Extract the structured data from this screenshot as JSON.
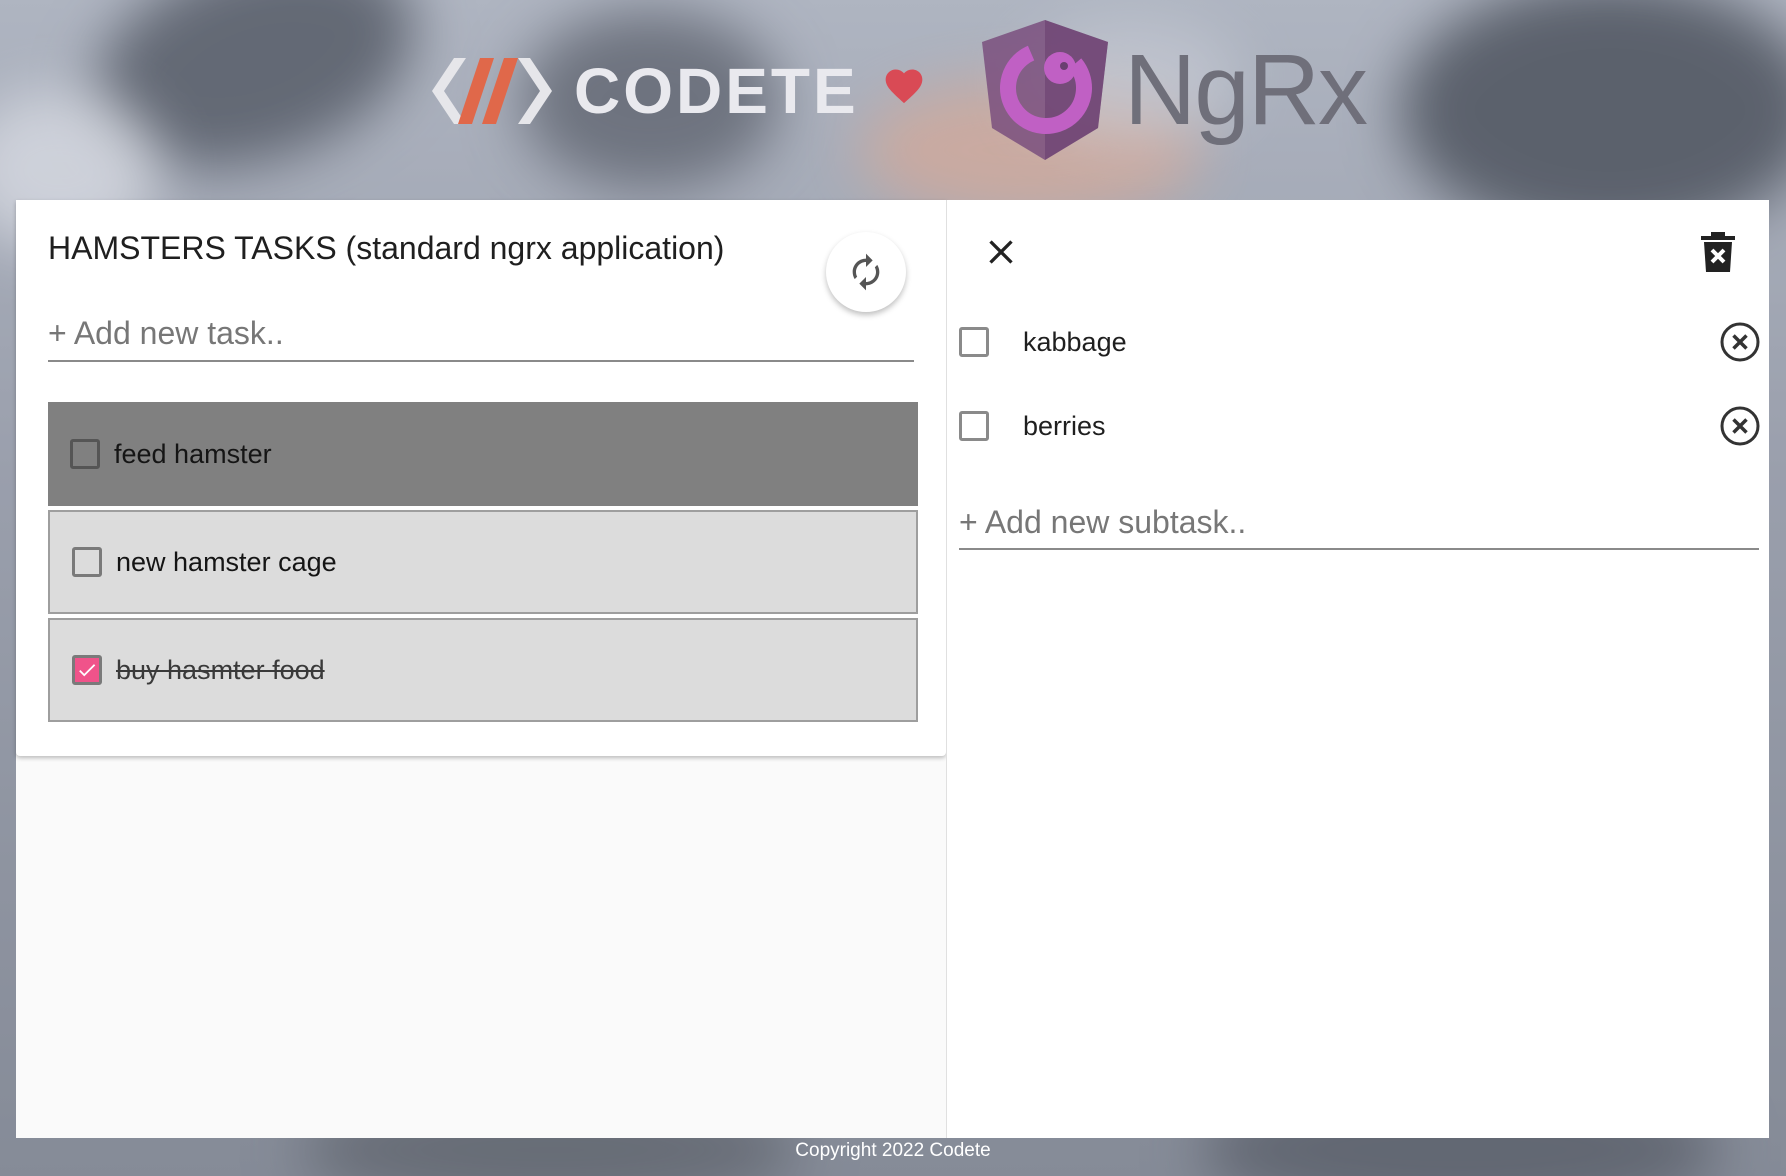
{
  "header": {
    "codete_logo_text": "CODETE",
    "ngrx_logo_text": "NgRx"
  },
  "tasks_panel": {
    "title": "HAMSTERS TASKS (standard ngrx application)",
    "add_task_placeholder": "+ Add new task..",
    "refresh_icon": "refresh-icon",
    "tasks": [
      {
        "label": "feed hamster",
        "completed": false,
        "selected": true
      },
      {
        "label": "new hamster cage",
        "completed": false,
        "selected": false
      },
      {
        "label": "buy hasmter food",
        "completed": true,
        "selected": false
      }
    ]
  },
  "detail_panel": {
    "close_icon": "close-icon",
    "delete_icon": "delete-icon",
    "subtasks": [
      {
        "label": "kabbage",
        "completed": false
      },
      {
        "label": "berries",
        "completed": false
      }
    ],
    "add_subtask_placeholder": "+ Add new subtask.."
  },
  "footer": {
    "copyright": "Copyright 2022 Codete"
  },
  "colors": {
    "accent_pink": "#f0538a",
    "selected_task_bg": "#808080",
    "task_bg": "#dcdcdc",
    "heart": "#d94a55",
    "ngrx_purple": "#8e3b8f"
  }
}
